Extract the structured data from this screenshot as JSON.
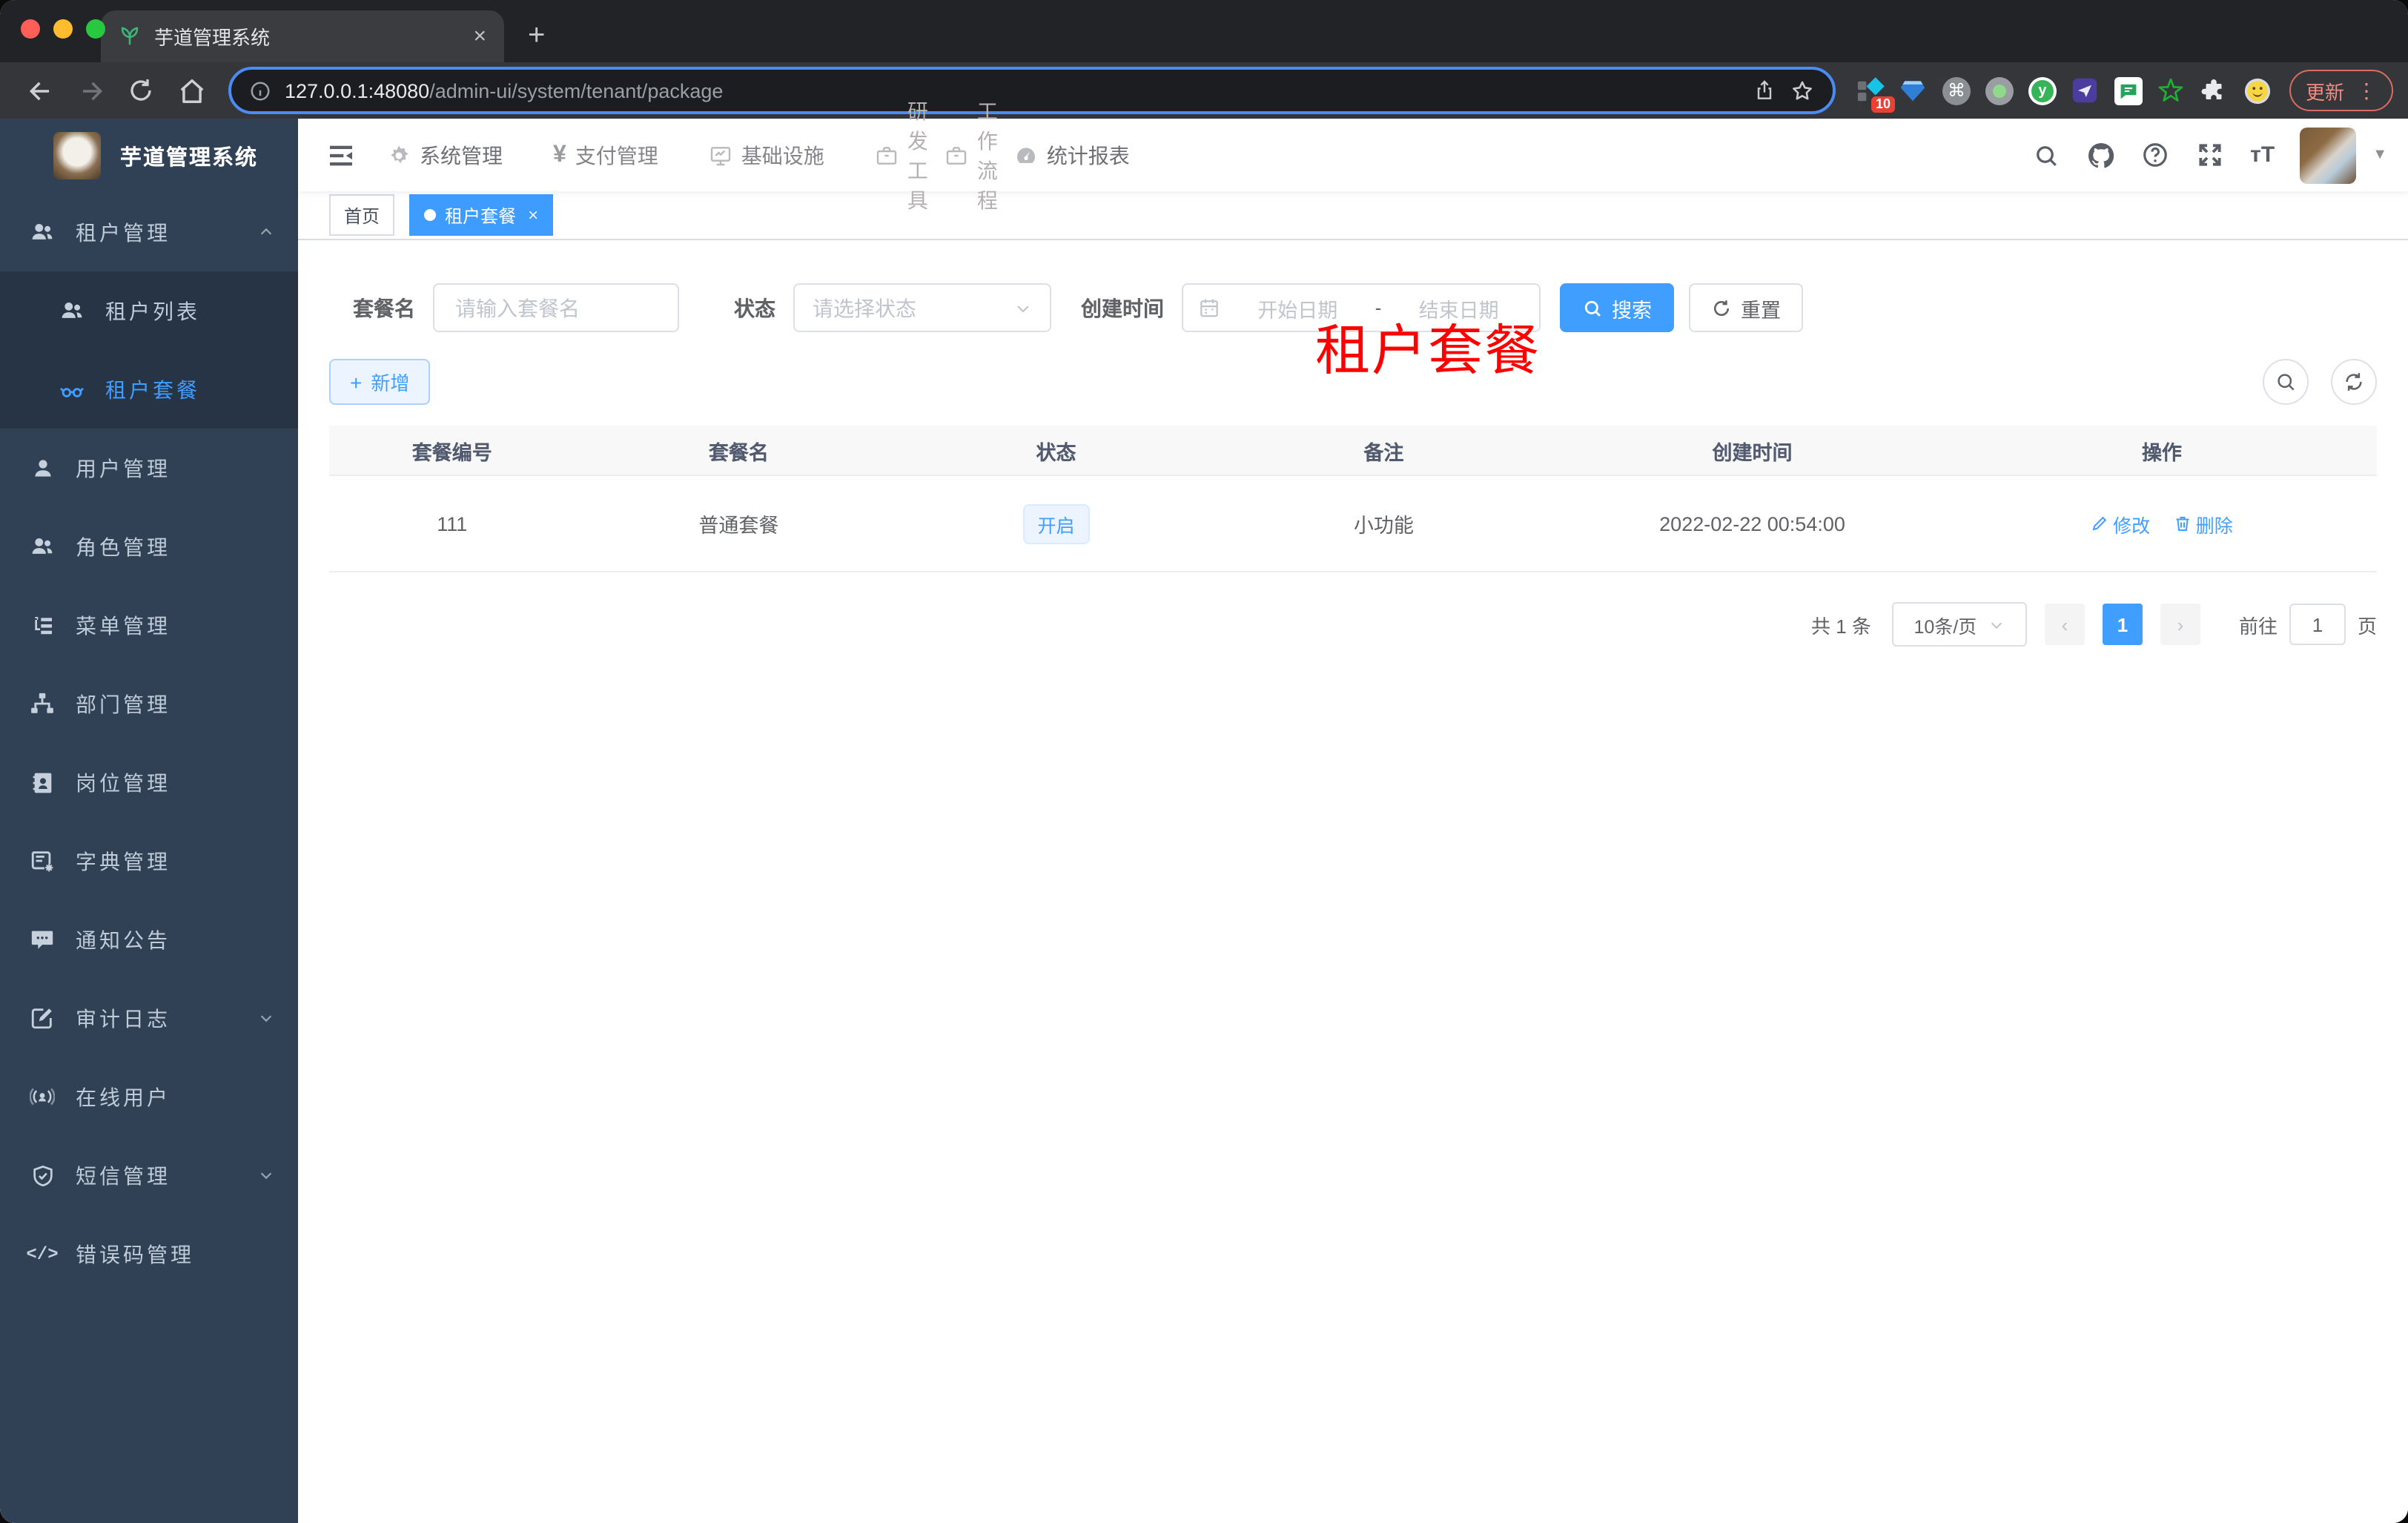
{
  "browser": {
    "tab_title": "芋道管理系统",
    "close_glyph": "×",
    "newtab_glyph": "+",
    "url_host": "127.0.0.1:48080",
    "url_path": "/admin-ui/system/tenant/package",
    "ext_badge": "10",
    "update_label": "更新",
    "menu_dots": "⋮"
  },
  "topnav": {
    "items": [
      {
        "label": "系统管理"
      },
      {
        "label": "支付管理"
      },
      {
        "label": "基础设施"
      },
      {
        "label": "研发工具"
      },
      {
        "label": "工作流程"
      },
      {
        "label": "统计报表"
      }
    ],
    "yen_glyph": "¥",
    "font_size_glyph": "тT"
  },
  "sidebar": {
    "logo_title": "芋道管理系统",
    "items": [
      {
        "label": "租户管理"
      },
      {
        "label": "租户列表"
      },
      {
        "label": "租户套餐"
      },
      {
        "label": "用户管理"
      },
      {
        "label": "角色管理"
      },
      {
        "label": "菜单管理"
      },
      {
        "label": "部门管理"
      },
      {
        "label": "岗位管理"
      },
      {
        "label": "字典管理"
      },
      {
        "label": "通知公告"
      },
      {
        "label": "审计日志"
      },
      {
        "label": "在线用户"
      },
      {
        "label": "短信管理"
      },
      {
        "label": "错误码管理"
      }
    ],
    "code_glyph": "</>"
  },
  "tags": {
    "home": "首页",
    "active": "租户套餐",
    "close_glyph": "×"
  },
  "annotation": "租户套餐",
  "filters": {
    "name_label": "套餐名",
    "name_placeholder": "请输入套餐名",
    "status_label": "状态",
    "status_placeholder": "请选择状态",
    "date_label": "创建时间",
    "date_start_placeholder": "开始日期",
    "date_separator": "-",
    "date_end_placeholder": "结束日期",
    "search_label": "搜索",
    "reset_label": "重置"
  },
  "actions": {
    "add_label": "新增",
    "plus_glyph": "+"
  },
  "table": {
    "headers": [
      "套餐编号",
      "套餐名",
      "状态",
      "备注",
      "创建时间",
      "操作"
    ],
    "rows": [
      {
        "id": "111",
        "name": "普通套餐",
        "status": "开启",
        "remark": "小功能",
        "created": "2022-02-22 00:54:00",
        "edit_label": "修改",
        "delete_label": "删除"
      }
    ]
  },
  "pagination": {
    "total": "共 1 条",
    "page_size": "10条/页",
    "prev_glyph": "‹",
    "next_glyph": "›",
    "current_page": "1",
    "goto_label": "前往",
    "goto_value": "1",
    "unit_label": "页"
  },
  "colors": {
    "accent": "#409eff",
    "sidebar_bg": "#304156",
    "submenu_bg": "#263445",
    "annotation_red": "#ff0000",
    "tag_active_bg": "#3e9cff"
  }
}
